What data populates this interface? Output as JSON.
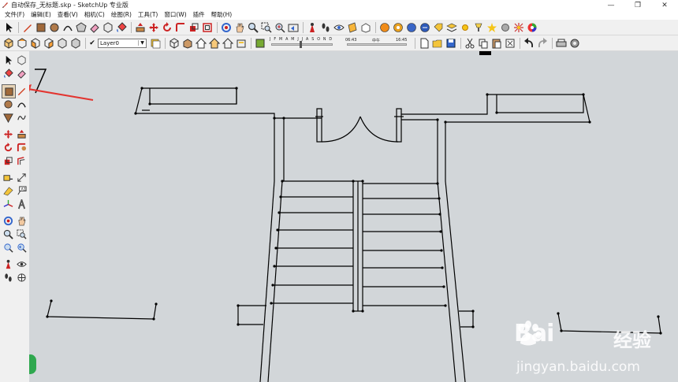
{
  "window": {
    "title": "自动保存_无标题.skp - SketchUp 专业版",
    "controls": [
      "minimize-icon",
      "maximize-icon",
      "close-icon"
    ]
  },
  "menu": {
    "items": [
      "文件(F)",
      "编辑(E)",
      "查看(V)",
      "相机(C)",
      "绘图(R)",
      "工具(T)",
      "窗口(W)",
      "插件",
      "帮助(H)"
    ]
  },
  "layers": {
    "current": "Layer0"
  },
  "shadow": {
    "months": "J F M A M J J A S O N D",
    "time_start": "06:43",
    "time_mid": "中午",
    "time_end": "16:45"
  },
  "watermark": {
    "brand": "Bai",
    "brand_cn": "经验",
    "url": "jingyan.baidu.com"
  },
  "colors": {
    "canvas": "#d2d6d9",
    "toolbar": "#f0f0f0",
    "annotation_arrow": "#e3342f",
    "line": "#000000"
  }
}
